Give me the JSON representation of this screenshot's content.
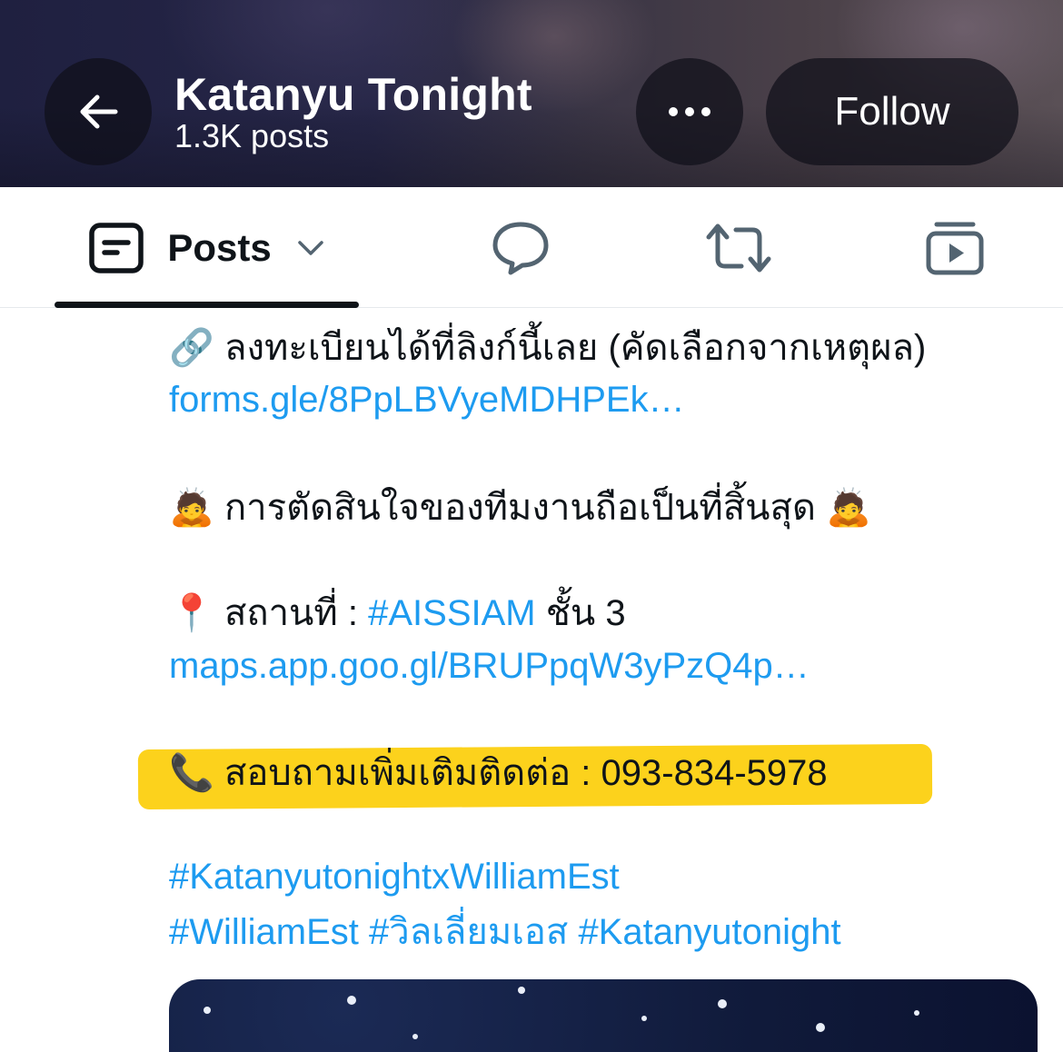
{
  "header": {
    "title": "Katanyu Tonight",
    "post_count": "1.3K posts",
    "follow_label": "Follow"
  },
  "tabs": {
    "posts_label": "Posts"
  },
  "post": {
    "lines": {
      "register_emoji": "🔗",
      "register_text": "ลงทะเบียนได้ที่ลิงก์นี้เลย (คัดเลือกจากเหตุผล)",
      "register_link": "forms.gle/8PpLBVyeMDHPEk…",
      "decision_emoji": "🙇",
      "decision_text": "การตัดสินใจของทีมงานถือเป็นที่สิ้นสุด",
      "decision_emoji_end": "🙇",
      "location_emoji": "📍",
      "location_prefix": "สถานที่ : ",
      "location_hashtag": "#AISSIAM",
      "location_suffix": " ชั้น 3",
      "maps_link": "maps.app.goo.gl/BRUPpqW3yPzQ4p…",
      "contact_emoji": "📞",
      "contact_text": "สอบถามเพิ่มเติมติดต่อ : 093-834-5978",
      "hashtag_1": "#KatanyutonightxWilliamEst",
      "hashtag_2": "#WilliamEst",
      "hashtag_3": "#วิลเลี่ยมเอส",
      "hashtag_4": "#Katanyutonight"
    }
  },
  "icons": {
    "back": "arrow-left-icon",
    "more": "more-horizontal-icon",
    "posts": "posts-tab-icon",
    "chevron": "chevron-down-icon",
    "replies": "speech-bubble-icon",
    "reposts": "repost-icon",
    "media": "video-play-icon"
  },
  "colors": {
    "link": "#1d9bf0",
    "highlight": "#fcd21c",
    "text": "#0f1419"
  }
}
